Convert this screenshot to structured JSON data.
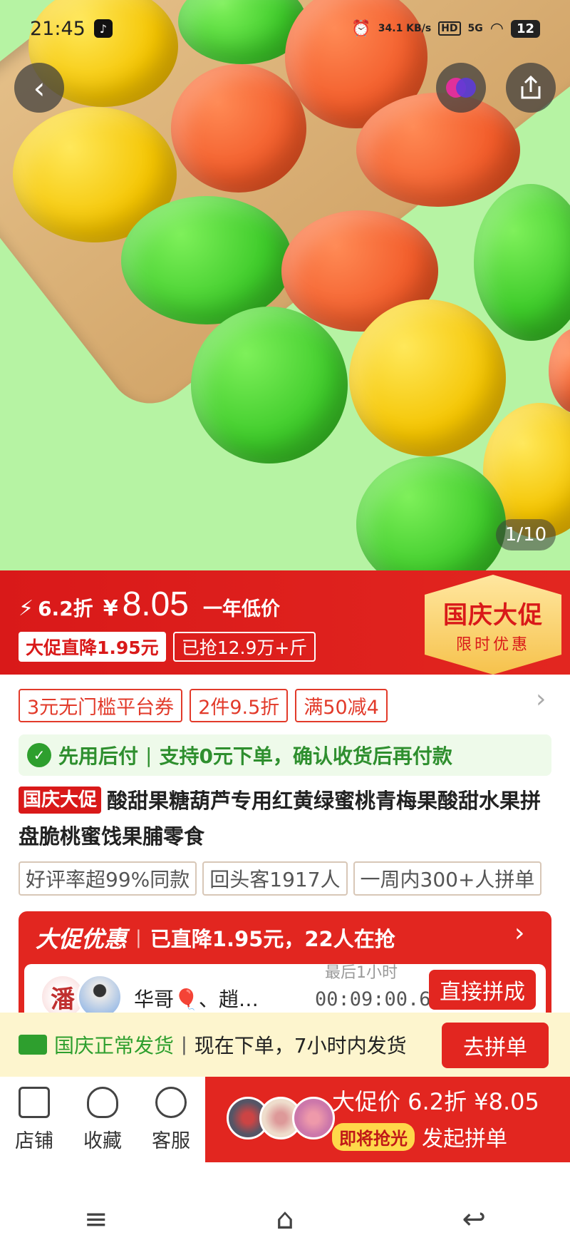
{
  "status_bar": {
    "time": "21:45",
    "net_speed": "34.1 KB/s",
    "hd": "HD",
    "signal": "5G",
    "battery": "12"
  },
  "gallery": {
    "counter": "1/10"
  },
  "price": {
    "discount": "6.2折",
    "currency": "¥",
    "amount": "8.05",
    "note": "一年低价",
    "tag_drop": "大促直降1.95元",
    "tag_sold": "已抢12.9万+斤",
    "badge_title": "国庆大促",
    "badge_sub": "限时优惠"
  },
  "coupons": [
    "3元无门槛平台券",
    "2件9.5折",
    "满50减4"
  ],
  "pay_later": {
    "title": "先用后付",
    "desc": "支持0元下单，确认收货后再付款"
  },
  "product": {
    "tag": "国庆大促",
    "title": "酸甜果糖葫芦专用红黄绿蜜桃青梅果酸甜水果拼盘脆桃蜜饯果脯零食"
  },
  "stats": [
    "好评率超99%同款",
    "回头客1917人",
    "一周内300+人拼单"
  ],
  "group": {
    "label": "大促优惠",
    "summary": "已直降1.95元，22人在抢",
    "names": "华哥🎈、趙…",
    "avatar_char": "潘",
    "countdown_label": "最后1小时",
    "countdown": "00:09:00.6",
    "join_label": "直接拼成"
  },
  "shipping": {
    "status": "国庆正常发货",
    "desc": "现在下单，7小时内发货",
    "button": "去拼单"
  },
  "actions": {
    "store": "店铺",
    "favorite": "收藏",
    "service": "客服"
  },
  "buy": {
    "line1": "大促价 6.2折 ¥8.05",
    "soon": "即将抢光",
    "start": "发起拼单"
  },
  "colors": {
    "accent": "#e22620",
    "green": "#2e9f2e",
    "gold": "#f6c24c"
  }
}
